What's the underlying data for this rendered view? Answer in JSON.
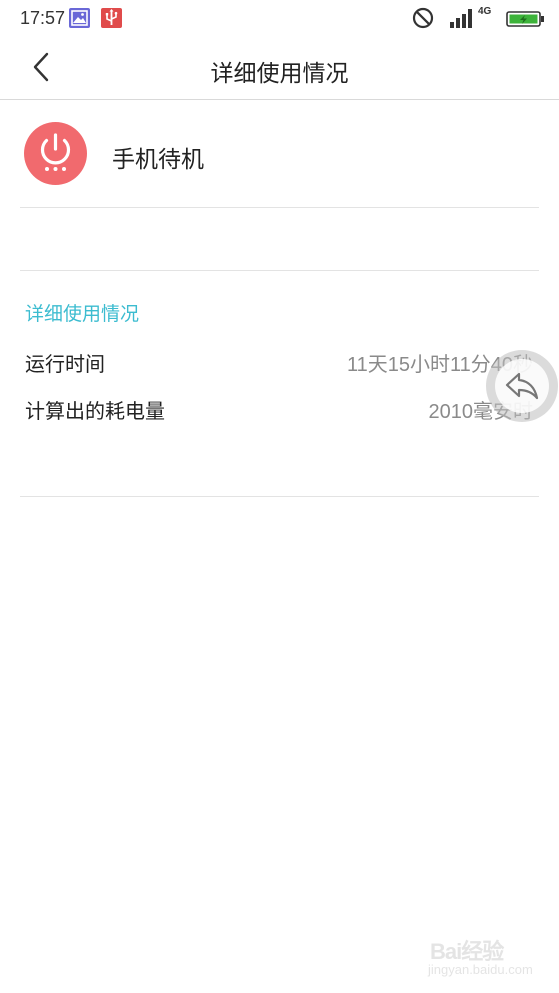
{
  "status_bar": {
    "time": "17:57",
    "network": "4G",
    "icons": [
      "gallery-icon",
      "usb-icon",
      "do-not-disturb-icon",
      "signal-icon",
      "battery-charging-icon"
    ],
    "battery_color": "#3db33a"
  },
  "header": {
    "title": "详细使用情况"
  },
  "app": {
    "name": "手机待机",
    "icon": "power-icon",
    "icon_color": "#f16a6e"
  },
  "details": {
    "section_title": "详细使用情况",
    "section_title_color": "#3cbcd0",
    "rows": [
      {
        "label": "运行时间",
        "value": "11天15小时11分40秒"
      },
      {
        "label": "计算出的耗电量",
        "value": "2010毫安时"
      }
    ]
  },
  "floating_back": {
    "icon": "reply-arrow-icon"
  },
  "watermark": {
    "brand": "Bai经验",
    "url": "jingyan.baidu.com"
  }
}
